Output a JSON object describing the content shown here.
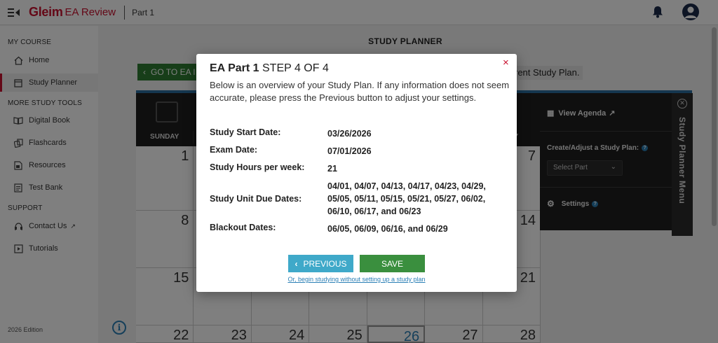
{
  "topbar": {
    "brand": "Gleim",
    "brand_sub": "EA Review",
    "part": "Part 1"
  },
  "sidebar": {
    "sections": [
      {
        "title": "MY COURSE",
        "items": [
          {
            "label": "Home",
            "icon": "home-icon"
          },
          {
            "label": "Study Planner",
            "icon": "calendar-icon",
            "active": true
          }
        ]
      },
      {
        "title": "MORE STUDY TOOLS",
        "items": [
          {
            "label": "Digital Book",
            "icon": "book-icon"
          },
          {
            "label": "Flashcards",
            "icon": "flashcards-icon"
          },
          {
            "label": "Resources",
            "icon": "resources-icon"
          },
          {
            "label": "Test Bank",
            "icon": "test-bank-icon"
          }
        ]
      },
      {
        "title": "SUPPORT",
        "items": [
          {
            "label": "Contact Us",
            "icon": "contact-icon"
          },
          {
            "label": "Tutorials",
            "icon": "play-icon"
          }
        ]
      }
    ],
    "edition": "2026 Edition"
  },
  "main": {
    "title": "STUDY PLANNER",
    "goto_label": "GO TO EA I",
    "current_plan_text": "rent Study Plan.",
    "day_names": [
      "SUNDAY",
      "",
      "",
      "",
      "",
      "",
      "DAY"
    ],
    "weeks": [
      [
        "1",
        "",
        "",
        "",
        "",
        "",
        "7"
      ],
      [
        "8",
        "",
        "",
        "",
        "",
        "",
        "14"
      ],
      [
        "15",
        "",
        "",
        "",
        "",
        "",
        "21"
      ],
      [
        "22",
        "23",
        "24",
        "25",
        "26",
        "27",
        "28"
      ]
    ],
    "today": "26"
  },
  "planner_menu": {
    "view_agenda": "View Agenda",
    "create_adjust": "Create/Adjust a Study Plan:",
    "select_part": "Select Part",
    "settings": "Settings",
    "tab_label": "Study Planner Menu"
  },
  "modal": {
    "title_strong": "EA Part 1",
    "title_step": "STEP 4 OF 4",
    "close": "×",
    "description": "Below is an overview of your Study Plan. If any information does not seem accurate, please press the Previous button to adjust your settings.",
    "rows": [
      {
        "label": "Study Start Date:",
        "value": "03/26/2026"
      },
      {
        "label": "Exam Date:",
        "value": "07/01/2026"
      },
      {
        "label": "Study Hours per week:",
        "value": "21"
      },
      {
        "label": "Study Unit Due Dates:",
        "value": "04/01, 04/07, 04/13, 04/17, 04/23, 04/29, 05/05, 05/11, 05/15, 05/21, 05/27, 06/02, 06/10, 06/17, and 06/23"
      },
      {
        "label": "Blackout Dates:",
        "value": "06/05, 06/09, 06/16, and 06/29"
      }
    ],
    "previous_label": "PREVIOUS",
    "save_label": "SAVE",
    "skip_link": "Or, begin studying without setting up a study plan"
  },
  "colors": {
    "brand_red": "#c8102e",
    "green": "#3a8f3e",
    "blue": "#3fa9c9",
    "link_blue": "#2a7fb5"
  }
}
